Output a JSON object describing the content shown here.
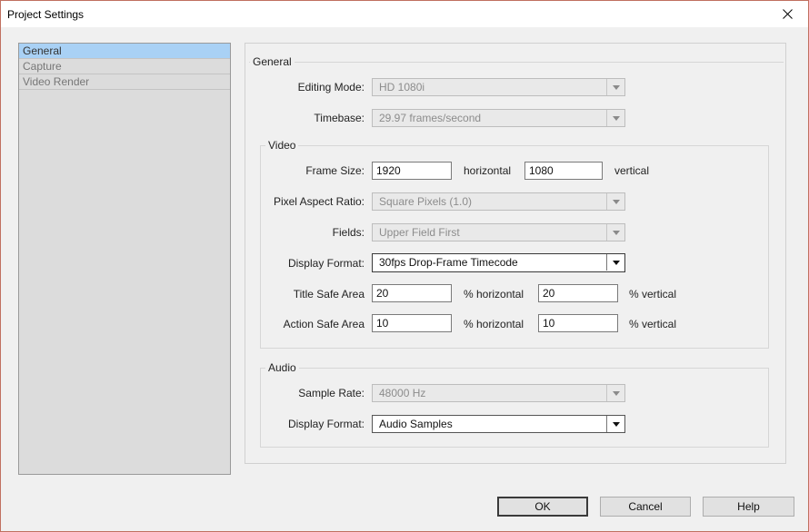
{
  "window": {
    "title": "Project Settings"
  },
  "nav": {
    "items": [
      "General",
      "Capture",
      "Video Render"
    ]
  },
  "general": {
    "group_label": "General",
    "editing_mode": {
      "label": "Editing Mode:",
      "value": "HD 1080i"
    },
    "timebase": {
      "label": "Timebase:",
      "value": "29.97 frames/second"
    }
  },
  "video": {
    "group_label": "Video",
    "frame_size": {
      "label": "Frame Size:",
      "horizontal_value": "1920",
      "horizontal_label": "horizontal",
      "vertical_value": "1080",
      "vertical_label": "vertical"
    },
    "pixel_aspect": {
      "label": "Pixel Aspect Ratio:",
      "value": "Square Pixels (1.0)"
    },
    "fields": {
      "label": "Fields:",
      "value": "Upper Field First"
    },
    "display_format": {
      "label": "Display Format:",
      "value": "30fps Drop-Frame Timecode"
    },
    "title_safe": {
      "label": "Title Safe Area",
      "horizontal_value": "20",
      "horizontal_label": "% horizontal",
      "vertical_value": "20",
      "vertical_label": "% vertical"
    },
    "action_safe": {
      "label": "Action Safe Area",
      "horizontal_value": "10",
      "horizontal_label": "% horizontal",
      "vertical_value": "10",
      "vertical_label": "% vertical"
    }
  },
  "audio": {
    "group_label": "Audio",
    "sample_rate": {
      "label": "Sample Rate:",
      "value": "48000 Hz"
    },
    "display_format": {
      "label": "Display Format:",
      "value": "Audio Samples"
    }
  },
  "buttons": {
    "ok": "OK",
    "cancel": "Cancel",
    "help": "Help"
  }
}
